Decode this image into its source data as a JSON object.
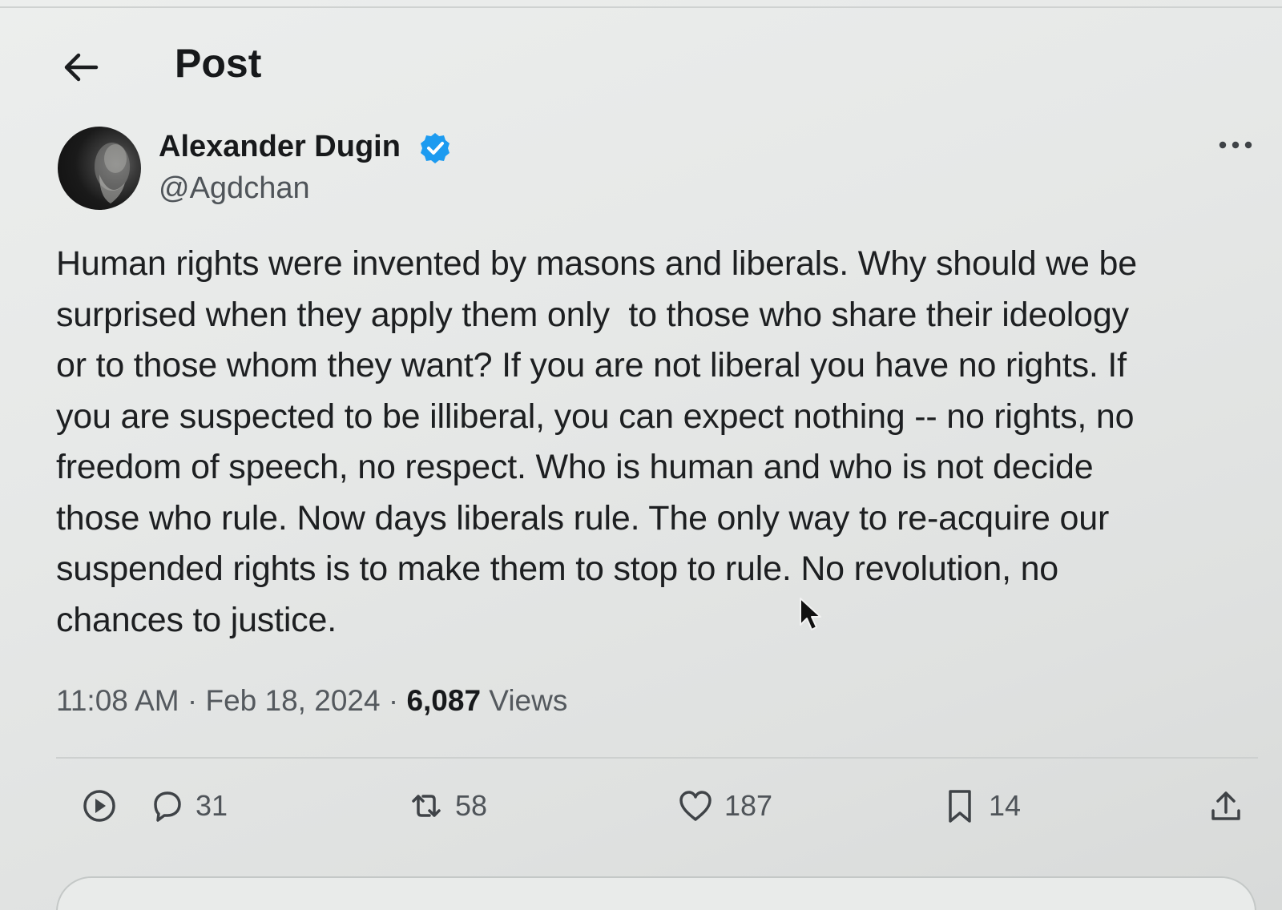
{
  "header": {
    "title": "Post",
    "back_icon": "arrow-left-icon"
  },
  "author": {
    "name": "Alexander Dugin",
    "handle": "@Agdchan",
    "verified": true,
    "verified_color": "#1d9bf0"
  },
  "post": {
    "lines": [
      "Human rights were invented by masons and liberals. Why should we be",
      "surprised when they apply them only  to those who share their ideology",
      "or to those whom they want? If you are not liberal you have no rights. If",
      "you are suspected to be illiberal, you can expect nothing -- no rights, no",
      "freedom of speech, no respect. Who is human and who is not decide",
      "those who rule. Now days liberals rule. The only way to re-acquire our",
      "suspended rights is to make them to stop to rule. No revolution, no",
      "chances to justice."
    ],
    "time": "11:08 AM",
    "separator": " · ",
    "date": "Feb 18, 2024",
    "views_count": "6,087",
    "views_label": " Views"
  },
  "actions": {
    "view_icon": "play-circle-icon",
    "replies": "31",
    "reposts": "58",
    "likes": "187",
    "bookmarks": "14",
    "share_icon": "share-upload-icon"
  }
}
